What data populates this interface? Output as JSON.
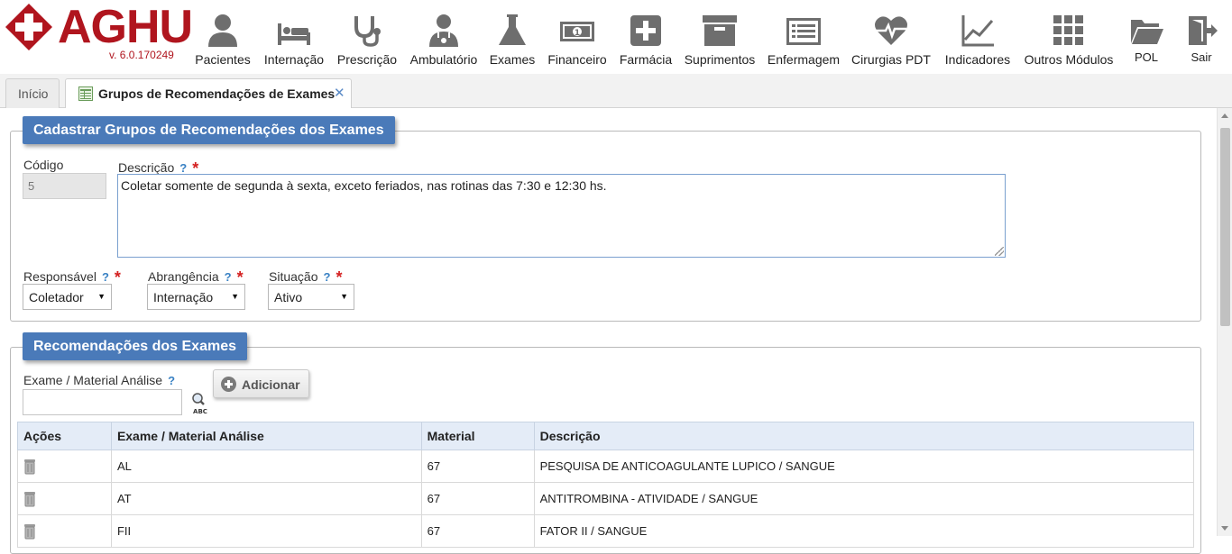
{
  "app": {
    "brand": "AGHU",
    "version": "v. 6.0.170249"
  },
  "modules": [
    {
      "label": "Pacientes",
      "icon": "person-icon"
    },
    {
      "label": "Internação",
      "icon": "bed-icon"
    },
    {
      "label": "Prescrição",
      "icon": "stethoscope-icon"
    },
    {
      "label": "Ambulatório",
      "icon": "doctor-icon"
    },
    {
      "label": "Exames",
      "icon": "flask-icon"
    },
    {
      "label": "Financeiro",
      "icon": "money-icon"
    },
    {
      "label": "Farmácia",
      "icon": "plus-box-icon"
    },
    {
      "label": "Suprimentos",
      "icon": "archive-box-icon"
    },
    {
      "label": "Enfermagem",
      "icon": "clipboard-list-icon"
    },
    {
      "label": "Cirurgias PDT",
      "icon": "heart-pulse-icon"
    },
    {
      "label": "Indicadores",
      "icon": "line-chart-icon"
    },
    {
      "label": "Outros Módulos",
      "icon": "grid-icon"
    },
    {
      "label": "POL",
      "icon": "folder-icon"
    },
    {
      "label": "Sair",
      "icon": "exit-door-icon"
    }
  ],
  "tabs": {
    "home": "Início",
    "active": "Grupos de Recomendações de Exames",
    "close_glyph": "✕"
  },
  "form": {
    "title": "Cadastrar Grupos de Recomendações dos Exames",
    "codigo_label": "Código",
    "codigo_value": "5",
    "descricao_label": "Descrição",
    "descricao_value": "Coletar somente de segunda à sexta, exceto feriados, nas rotinas das 7:30 e 12:30 hs.",
    "help_glyph": "?",
    "required_glyph": "*",
    "responsavel_label": "Responsável",
    "responsavel_value": "Coletador",
    "abrangencia_label": "Abrangência",
    "abrangencia_value": "Internação",
    "situacao_label": "Situação",
    "situacao_value": "Ativo",
    "select_arrow": "▼"
  },
  "recomendacoes": {
    "title": "Recomendações dos Exames",
    "exame_label": "Exame / Material Análise",
    "exame_value": "",
    "add_button": "Adicionar",
    "columns": [
      "Ações",
      "Exame / Material Análise",
      "Material",
      "Descrição"
    ],
    "rows": [
      {
        "exame": "AL",
        "material": "67",
        "descricao": "PESQUISA DE ANTICOAGULANTE LUPICO / SANGUE"
      },
      {
        "exame": "AT",
        "material": "67",
        "descricao": "ANTITROMBINA - ATIVIDADE / SANGUE"
      },
      {
        "exame": "FII",
        "material": "67",
        "descricao": "FATOR II / SANGUE"
      }
    ]
  },
  "colors": {
    "brand_red": "#b0151e",
    "panel_title_blue": "#4a7ab9",
    "table_header_bg": "#e4ecf7",
    "icon_gray": "#6e6e6e",
    "help_blue": "#3a82c4",
    "required_red": "#d42020"
  }
}
